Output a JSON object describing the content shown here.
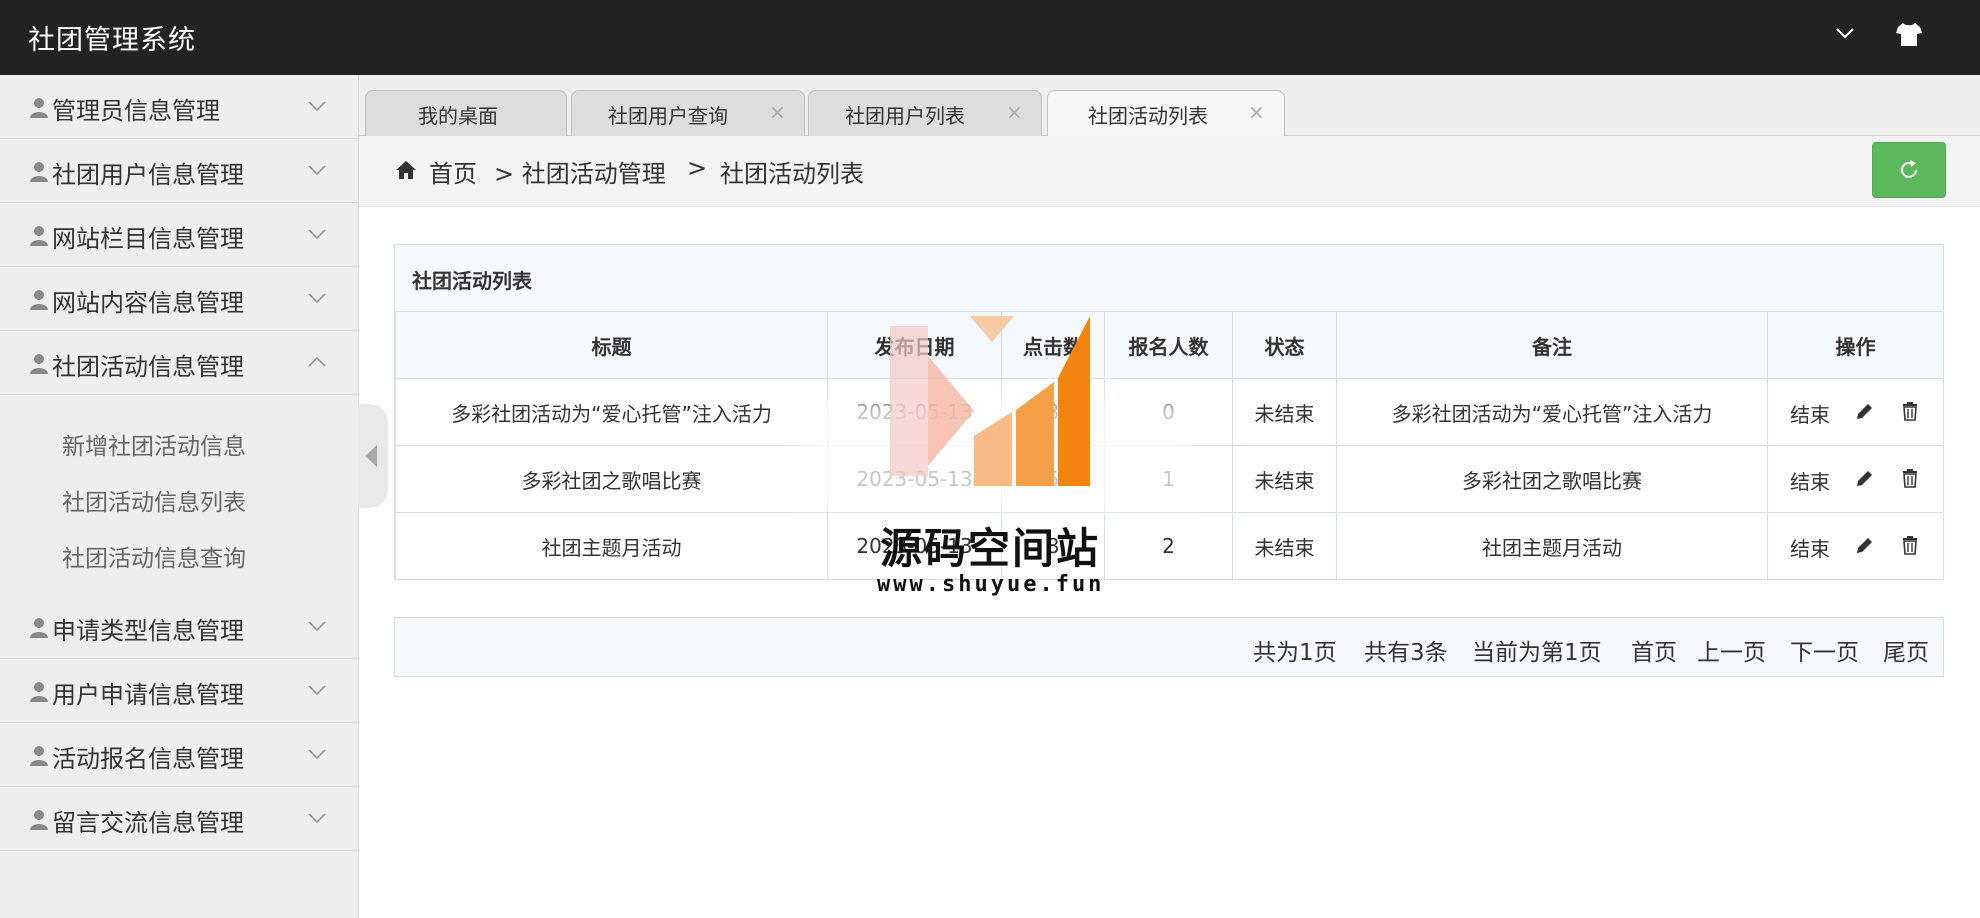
{
  "app": {
    "title": "社团管理系统"
  },
  "topbar": {
    "icons": [
      "chevron-down-icon",
      "shirt-icon"
    ]
  },
  "sidebar": {
    "items": [
      {
        "label": "管理员信息管理",
        "expanded": false
      },
      {
        "label": "社团用户信息管理",
        "expanded": false
      },
      {
        "label": "网站栏目信息管理",
        "expanded": false
      },
      {
        "label": "网站内容信息管理",
        "expanded": false
      },
      {
        "label": "社团活动信息管理",
        "expanded": true,
        "children": [
          "新增社团活动信息",
          "社团活动信息列表",
          "社团活动信息查询"
        ]
      },
      {
        "label": "申请类型信息管理",
        "expanded": false
      },
      {
        "label": "用户申请信息管理",
        "expanded": false
      },
      {
        "label": "活动报名信息管理",
        "expanded": false
      },
      {
        "label": "留言交流信息管理",
        "expanded": false
      }
    ]
  },
  "tabs": [
    {
      "label": "我的桌面",
      "closable": false
    },
    {
      "label": "社团用户查询",
      "closable": true
    },
    {
      "label": "社团用户列表",
      "closable": true
    },
    {
      "label": "社团活动列表",
      "closable": true,
      "active": true
    }
  ],
  "tab_close_glyph": "×",
  "breadcrumb": {
    "home": "首页",
    "items": [
      "> 社团活动管理",
      ">",
      "社团活动列表"
    ]
  },
  "panel": {
    "title": "社团活动列表",
    "columns": [
      "标题",
      "发布日期",
      "点击数",
      "报名人数",
      "状态",
      "备注",
      "操作"
    ],
    "rows": [
      {
        "title": "多彩社团活动为“爱心托管”注入活力",
        "date": "2023-05-13",
        "clicks": "3",
        "signups": "0",
        "status": "未结束",
        "remark": "多彩社团活动为“爱心托管”注入活力",
        "action": "结束"
      },
      {
        "title": "多彩社团之歌唱比赛",
        "date": "2023-05-13",
        "clicks": "5",
        "signups": "1",
        "status": "未结束",
        "remark": "多彩社团之歌唱比赛",
        "action": "结束"
      },
      {
        "title": "社团主题月活动",
        "date": "2023-05-13",
        "clicks": "8",
        "signups": "2",
        "status": "未结束",
        "remark": "社团主题月活动",
        "action": "结束"
      }
    ]
  },
  "pager": {
    "total_pages": "共为1页",
    "total_records": "共有3条",
    "current": "当前为第1页",
    "first": "首页",
    "prev": "上一页",
    "next": "下一页",
    "last": "尾页"
  },
  "watermark": {
    "name": "源码空间站",
    "url": "www.shuyue.fun"
  },
  "colors": {
    "topbar": "#232323",
    "sidebar": "#eeeeee",
    "refresh": "#5cb85c",
    "panel_head": "#f5f8fc"
  }
}
